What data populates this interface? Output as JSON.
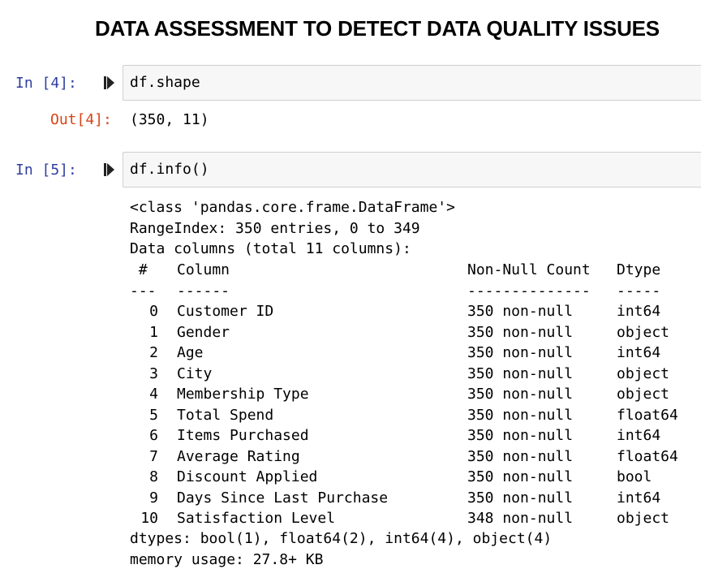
{
  "heading": "DATA ASSESSMENT TO DETECT DATA QUALITY ISSUES",
  "icons": {
    "run_cell": "run-step-icon"
  },
  "colors": {
    "in_prompt": "#303f9f",
    "out_prompt": "#d84315",
    "cell_background": "#f7f7f7"
  },
  "cells": [
    {
      "in_prompt": "In [4]:",
      "code": "df.shape",
      "out_prompt": "Out[4]:",
      "output": "(350, 11)"
    },
    {
      "in_prompt": "In [5]:",
      "code": "df.info()",
      "output_header": [
        "<class 'pandas.core.frame.DataFrame'>",
        "RangeIndex: 350 entries, 0 to 349",
        "Data columns (total 11 columns):"
      ],
      "table_headers": {
        "idx": " #",
        "column": "Column",
        "non_null": "Non-Null Count",
        "dtype": "Dtype"
      },
      "table_separators": {
        "idx": "---",
        "column": "------",
        "non_null": "--------------",
        "dtype": "-----"
      },
      "rows": [
        {
          "idx": "0",
          "column": "Customer ID",
          "non_null": "350 non-null",
          "dtype": "int64"
        },
        {
          "idx": "1",
          "column": "Gender",
          "non_null": "350 non-null",
          "dtype": "object"
        },
        {
          "idx": "2",
          "column": "Age",
          "non_null": "350 non-null",
          "dtype": "int64"
        },
        {
          "idx": "3",
          "column": "City",
          "non_null": "350 non-null",
          "dtype": "object"
        },
        {
          "idx": "4",
          "column": "Membership Type",
          "non_null": "350 non-null",
          "dtype": "object"
        },
        {
          "idx": "5",
          "column": "Total Spend",
          "non_null": "350 non-null",
          "dtype": "float64"
        },
        {
          "idx": "6",
          "column": "Items Purchased",
          "non_null": "350 non-null",
          "dtype": "int64"
        },
        {
          "idx": "7",
          "column": "Average Rating",
          "non_null": "350 non-null",
          "dtype": "float64"
        },
        {
          "idx": "8",
          "column": "Discount Applied",
          "non_null": "350 non-null",
          "dtype": "bool"
        },
        {
          "idx": "9",
          "column": "Days Since Last Purchase",
          "non_null": "350 non-null",
          "dtype": "int64"
        },
        {
          "idx": "10",
          "column": "Satisfaction Level",
          "non_null": "348 non-null",
          "dtype": "object"
        }
      ],
      "output_footer": [
        "dtypes: bool(1), float64(2), int64(4), object(4)",
        "memory usage: 27.8+ KB"
      ]
    }
  ]
}
